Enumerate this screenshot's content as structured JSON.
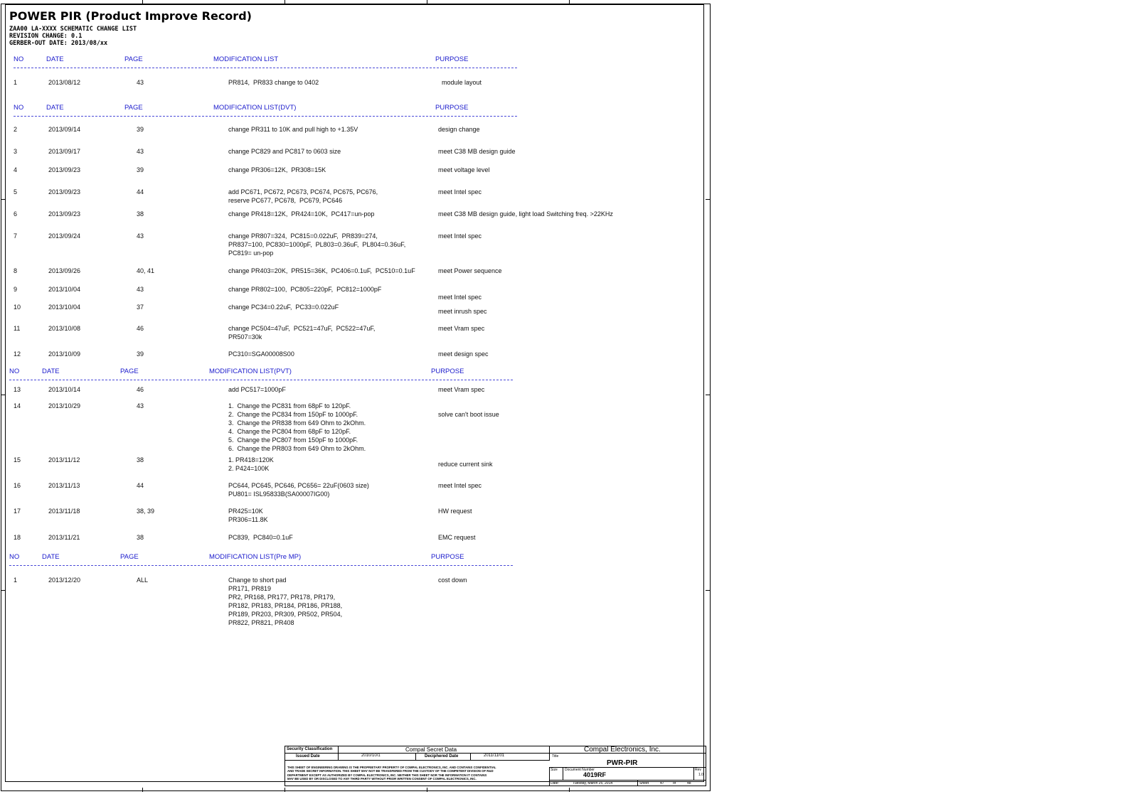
{
  "document": {
    "title": "POWER PIR (Product Improve Record)",
    "subtitle_lines": [
      "ZAA00 LA-XXXX SCHEMATIC CHANGE LIST",
      "REVISION CHANGE: 0.1",
      "GERBER-OUT DATE: 2013/08/xx"
    ]
  },
  "sections": [
    {
      "headers": {
        "no": "NO",
        "date": "DATE",
        "page": "PAGE",
        "list": "MODIFICATION LIST",
        "purpose": "PURPOSE"
      },
      "rows": [
        {
          "no": "1",
          "date": "2013/08/12",
          "page": "43",
          "mod": "PR814,  PR833 change to 0402",
          "purpose": "  module layout"
        }
      ]
    },
    {
      "headers": {
        "no": "NO",
        "date": "DATE",
        "page": "PAGE",
        "list": "MODIFICATION LIST(DVT)",
        "purpose": "PURPOSE"
      },
      "rows": [
        {
          "no": "2",
          "date": "2013/09/14",
          "page": "39",
          "mod": "change PR311 to 10K and pull high to +1.35V",
          "purpose": "design change"
        },
        {
          "no": "3",
          "date": "2013/09/17",
          "page": "43",
          "mod": "change PC829 and PC817 to 0603 size",
          "purpose": "meet C38 MB design guide"
        },
        {
          "no": "4",
          "date": "2013/09/23",
          "page": "39",
          "mod": "change PR306=12K,  PR308=15K",
          "purpose": "meet voltage level"
        },
        {
          "no": "5",
          "date": "2013/09/23",
          "page": "44",
          "mod": "add PC671, PC672, PC673, PC674, PC675, PC676,\nreserve PC677, PC678,  PC679, PC646",
          "purpose": "meet Intel spec"
        },
        {
          "no": "6",
          "date": "2013/09/23",
          "page": "38",
          "mod": "change PR418=12K,  PR424=10K,  PC417=un-pop",
          "purpose": "meet C38 MB design guide, light load Switching freq. >22KHz"
        },
        {
          "no": "7",
          "date": "2013/09/24",
          "page": "43",
          "mod": "change PR807=324,  PC815=0.022uF,  PR839=274,\nPR837=100, PC830=1000pF,  PL803=0.36uF,  PL804=0.36uF,\nPC819= un-pop",
          "purpose": "meet Intel spec"
        },
        {
          "no": "8",
          "date": "2013/09/26",
          "page": "40, 41",
          "mod": "change PR403=20K,  PR515=36K,  PC406=0.1uF,  PC510=0.1uF",
          "purpose": "meet Power sequence"
        },
        {
          "no": "9",
          "date": "2013/10/04",
          "page": "43",
          "mod": "change PR802=100,  PC805=220pF,  PC812=1000pF",
          "purpose": "meet Intel spec"
        },
        {
          "no": "10",
          "date": "2013/10/04",
          "page": "37",
          "mod": "change PC34=0.22uF,  PC33=0.022uF",
          "purpose": "meet inrush spec"
        },
        {
          "no": "11",
          "date": "2013/10/08",
          "page": "46",
          "mod": "change PC504=47uF,  PC521=47uF,  PC522=47uF,\nPR507=30k",
          "purpose": "meet Vram spec"
        },
        {
          "no": "12",
          "date": "2013/10/09",
          "page": "39",
          "mod": "PC310=SGA00008S00",
          "purpose": "meet design spec"
        }
      ]
    },
    {
      "headers": {
        "no": "NO",
        "date": "DATE",
        "page": "PAGE",
        "list": "MODIFICATION LIST(PVT)",
        "purpose": "PURPOSE"
      },
      "rows": [
        {
          "no": "13",
          "date": "2013/10/14",
          "page": "46",
          "mod": "add PC517=1000pF",
          "purpose": "meet Vram spec"
        },
        {
          "no": "14",
          "date": "2013/10/29",
          "page": "43",
          "mod": "1.  Change the PC831 from 68pF to 120pF.\n2.  Change the PC834 from 150pF to 1000pF.\n3.  Change the PR838 from 649 Ohm to 2kOhm.\n4.  Change the PC804 from 68pF to 120pF.\n5.  Change the PC807 from 150pF to 1000pF.\n6.  Change the PR803 from 649 Ohm to 2kOhm.",
          "purpose": "solve can't boot issue"
        },
        {
          "no": "15",
          "date": "2013/11/12",
          "page": "38",
          "mod": "1. PR418=120K\n2. P424=100K",
          "purpose": "reduce current sink"
        },
        {
          "no": "16",
          "date": "2013/11/13",
          "page": "44",
          "mod": "PC644, PC645, PC646, PC656= 22uF(0603 size)\nPU801= ISL95833B(SA00007IG00)",
          "purpose": "meet Intel spec"
        },
        {
          "no": "17",
          "date": "2013/11/18",
          "page": "38, 39",
          "mod": "PR425=10K\nPR306=11.8K",
          "purpose": "HW request"
        },
        {
          "no": "18",
          "date": "2013/11/21",
          "page": "38",
          "mod": "PC839,  PC840=0.1uF",
          "purpose": "EMC request"
        }
      ]
    },
    {
      "headers": {
        "no": "NO",
        "date": "DATE",
        "page": "PAGE",
        "list": "MODIFICATION LIST(Pre MP)",
        "purpose": "PURPOSE"
      },
      "rows": [
        {
          "no": "1",
          "date": "2013/12/20",
          "page": "ALL",
          "mod": "Change to short pad\nPR171, PR819\nPR2, PR168, PR177, PR178, PR179,\nPR182, PR183, PR184, PR186, PR188,\nPR189, PR203, PR309, PR502, PR504,\nPR822, PR821, PR408",
          "purpose": "cost down"
        }
      ]
    }
  ],
  "title_block": {
    "security_label": "Security Classification",
    "secret_label": "Compal Secret Data",
    "issued_label": "Issued Date",
    "issued_value": "2010/10/1",
    "deciphered_label": "Deciphered Date",
    "deciphered_value": "2011/11/01",
    "notice": "THIS SHEET OF ENGINEERING DRAWING IS THE PROPRIETARY PROPERTY OF COMPAL ELECTRONICS, INC. AND CONTAINS CONFIDENTIAL\nAND TRADE SECRET INFORMATION. THIS SHEET MAY NOT BE TRANSFERED FROM THE CUSTODY OF THE COMPETENT DIVISION OF R&D\nDEPARTMENT EXCEPT AS AUTHORIZED BY COMPAL ELECTRONICS, INC. NEITHER THIS SHEET NOR THE INFORMATION IT CONTAINS\nMAY BE USED BY OR DISCLOSED TO ANY THIRD PARTY WITHOUT PRIOR WRITTEN CONSENT OF COMPAL ELECTRONICS, INC.",
    "company": "Compal Electronics, Inc.",
    "title_label": "Title",
    "title_value": "PWR-PIR",
    "size_label": "Size",
    "docnum_label": "Document Number",
    "docnum_value": "4019RF",
    "rev_label": "Rev",
    "rev_value": "1.0",
    "date_label": "Date:",
    "date_value": "Tuesday, March 25, 2014",
    "sheet_label": "Sheet",
    "sheet_value": "47",
    "of_label": "of",
    "total_value": "48"
  }
}
